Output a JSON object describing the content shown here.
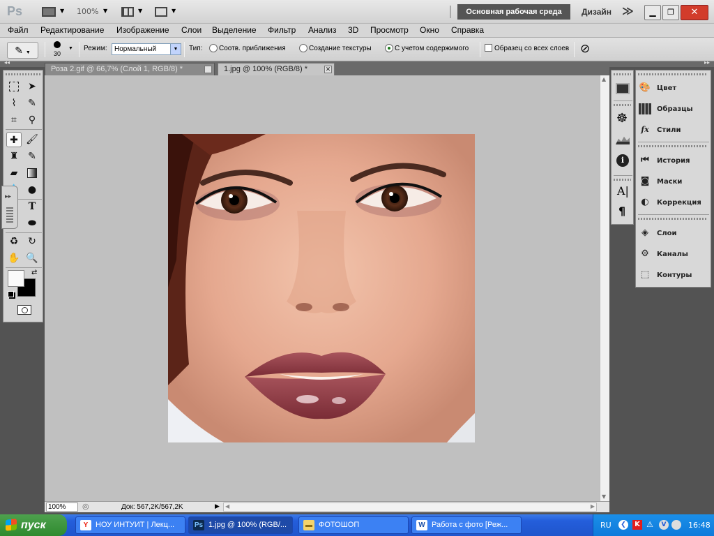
{
  "appbar": {
    "logo": "Ps",
    "zoom": "100%",
    "workspace_active": "Основная рабочая среда",
    "workspace_next": "Дизайн",
    "more": "≫"
  },
  "menu": [
    "Файл",
    "Редактирование",
    "Изображение",
    "Слои",
    "Выделение",
    "Фильтр",
    "Анализ",
    "3D",
    "Просмотр",
    "Окно",
    "Справка"
  ],
  "options": {
    "brush_size": "30",
    "mode_label": "Режим:",
    "mode_value": "Нормальный",
    "type_label": "Тип:",
    "type_options": [
      "Соотв. приближения",
      "Создание текстуры",
      "С учетом содержимого"
    ],
    "type_selected": "С учетом содержимого",
    "sample_all_layers": "Образец со всех слоев"
  },
  "tabs": [
    {
      "label": "Роза 2.gif @ 66,7% (Слой 1, RGB/8) *",
      "active": false
    },
    {
      "label": "1.jpg @ 100% (RGB/8) *",
      "active": true
    }
  ],
  "status": {
    "zoom": "100%",
    "doc": "Док: 567,2K/567,2K"
  },
  "panels": {
    "group1": [
      {
        "icon": "palette-icon",
        "label": "Цвет"
      },
      {
        "icon": "swatches-icon",
        "label": "Образцы"
      },
      {
        "icon": "fx-icon",
        "label": "Стили"
      }
    ],
    "group2": [
      {
        "icon": "history-icon",
        "label": "История"
      },
      {
        "icon": "mask-icon",
        "label": "Маски"
      },
      {
        "icon": "adjustment-icon",
        "label": "Коррекция"
      }
    ],
    "group3": [
      {
        "icon": "layers-icon",
        "label": "Слои"
      },
      {
        "icon": "channels-icon",
        "label": "Каналы"
      },
      {
        "icon": "paths-icon",
        "label": "Контуры"
      }
    ]
  },
  "taskbar": {
    "start": "пуск",
    "items": [
      {
        "icon": "yandex-icon",
        "label": "НОУ ИНТУИТ | Лекц...",
        "active": false
      },
      {
        "icon": "photoshop-icon",
        "label": "1.jpg @ 100% (RGB/...",
        "active": true
      },
      {
        "icon": "folder-icon",
        "label": "ФОТОШОП",
        "active": false
      },
      {
        "icon": "word-icon",
        "label": "Работа с фото [Реж...",
        "active": false
      }
    ],
    "lang": "RU",
    "clock": "16:48"
  },
  "colors": {
    "accent_taskbar": "#245edb",
    "start_green": "#2f8a2f",
    "canvas_bg": "#c0c0c0"
  }
}
